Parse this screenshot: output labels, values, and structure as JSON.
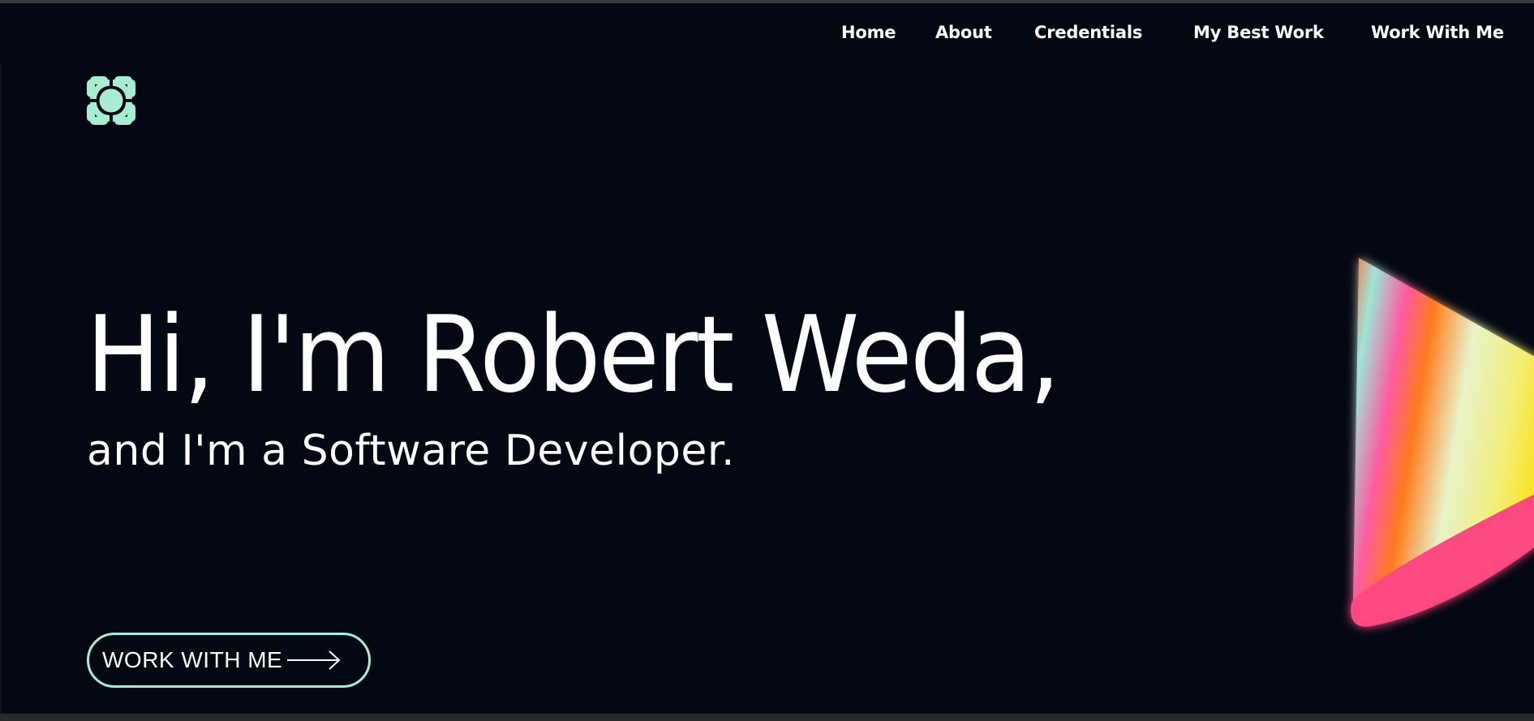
{
  "nav": {
    "items": [
      {
        "label": "Home"
      },
      {
        "label": "About"
      },
      {
        "label": "Credentials"
      },
      {
        "label": "My Best Work"
      },
      {
        "label": "Work With Me"
      }
    ]
  },
  "hero": {
    "title": "Hi, I'm Robert Weda,",
    "subtitle": "and I'm a Software Developer.",
    "cta_label": "WORK WITH ME"
  },
  "icons": {
    "logo": "logo-icon",
    "arrow": "arrow-right-icon"
  },
  "colors": {
    "background": "#030812",
    "accent": "#a8ecd2",
    "text": "#ffffff"
  }
}
